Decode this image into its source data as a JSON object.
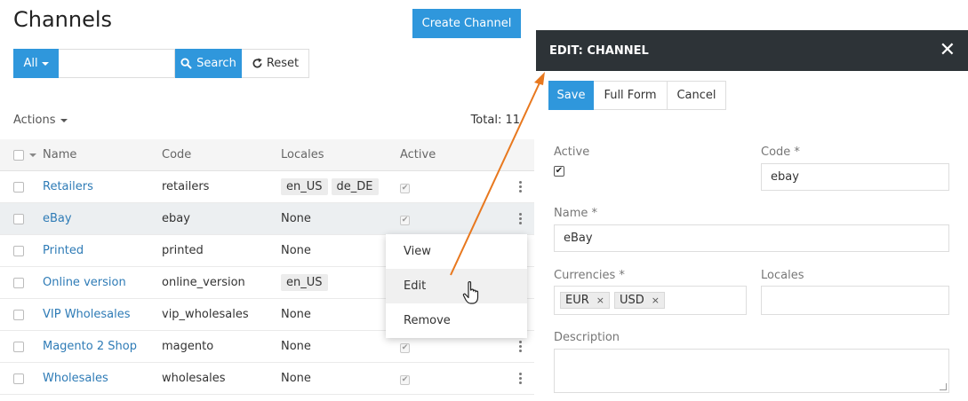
{
  "page": {
    "title": "Channels",
    "create_button": "Create Channel"
  },
  "search": {
    "filter_label": "All",
    "value": "",
    "placeholder": "",
    "search_button": "Search",
    "reset_button": "Reset"
  },
  "toolbar": {
    "actions_label": "Actions",
    "total_label": "Total: 11"
  },
  "grid": {
    "headers": {
      "name": "Name",
      "code": "Code",
      "locales": "Locales",
      "active": "Active"
    },
    "rows": [
      {
        "name": "Retailers",
        "code": "retailers",
        "locales": [
          "en_US",
          "de_DE"
        ],
        "locales_text": "",
        "active": true
      },
      {
        "name": "eBay",
        "code": "ebay",
        "locales": [],
        "locales_text": "None",
        "active": true
      },
      {
        "name": "Printed",
        "code": "printed",
        "locales": [],
        "locales_text": "None",
        "active": true
      },
      {
        "name": "Online version",
        "code": "online_version",
        "locales": [
          "en_US"
        ],
        "locales_text": "",
        "active": true
      },
      {
        "name": "VIP Wholesales",
        "code": "vip_wholesales",
        "locales": [],
        "locales_text": "None",
        "active": true
      },
      {
        "name": "Magento 2 Shop",
        "code": "magento",
        "locales": [],
        "locales_text": "None",
        "active": true
      },
      {
        "name": "Wholesales",
        "code": "wholesales",
        "locales": [],
        "locales_text": "None",
        "active": true
      }
    ]
  },
  "context_menu": {
    "items": [
      "View",
      "Edit",
      "Remove"
    ],
    "highlighted": "Edit"
  },
  "panel": {
    "title": "EDIT: CHANNEL",
    "buttons": {
      "save": "Save",
      "full_form": "Full Form",
      "cancel": "Cancel"
    },
    "fields": {
      "active_label": "Active",
      "active_checked": true,
      "code_label": "Code *",
      "code_value": "ebay",
      "name_label": "Name *",
      "name_value": "eBay",
      "currencies_label": "Currencies *",
      "currencies": [
        "EUR",
        "USD"
      ],
      "locales_label": "Locales",
      "locales_value": "",
      "description_label": "Description",
      "description_value": ""
    }
  },
  "colors": {
    "primary": "#2f97dc",
    "panel_header": "#2d3337",
    "link": "#2e7bb6",
    "arrow": "#e8781e"
  },
  "icons": {
    "search": "search-icon",
    "reset": "reset-icon",
    "close": "close-icon",
    "kebab": "kebab-menu-icon",
    "cursor": "hand-pointer-icon"
  }
}
